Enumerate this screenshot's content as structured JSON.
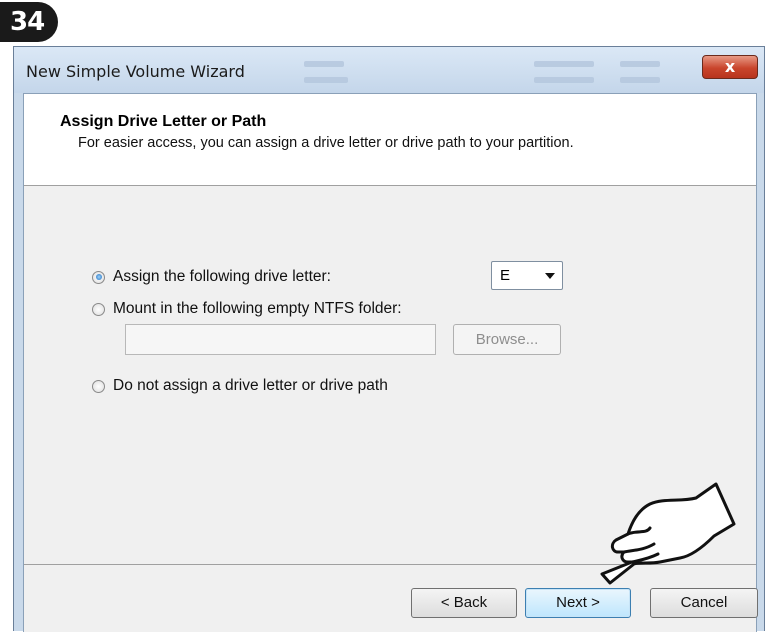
{
  "step_badge": "34",
  "window": {
    "title": "New Simple Volume Wizard",
    "close_label": "x"
  },
  "header": {
    "title": "Assign Drive Letter or Path",
    "subtitle": "For easier access, you can assign a drive letter or drive path to your partition."
  },
  "options": {
    "assign_letter": "Assign the following drive letter:",
    "mount_folder": "Mount in the following empty NTFS folder:",
    "no_assign": "Do not assign a drive letter or drive path",
    "selected": "assign_letter"
  },
  "drive_letter": {
    "value": "E"
  },
  "folder_path": {
    "value": ""
  },
  "buttons": {
    "browse": "Browse...",
    "back": "< Back",
    "next": "Next >",
    "cancel": "Cancel"
  },
  "icons": {
    "pointing_hand": "pointing-hand-icon",
    "close": "close-icon",
    "dropdown": "chevron-down-icon"
  }
}
